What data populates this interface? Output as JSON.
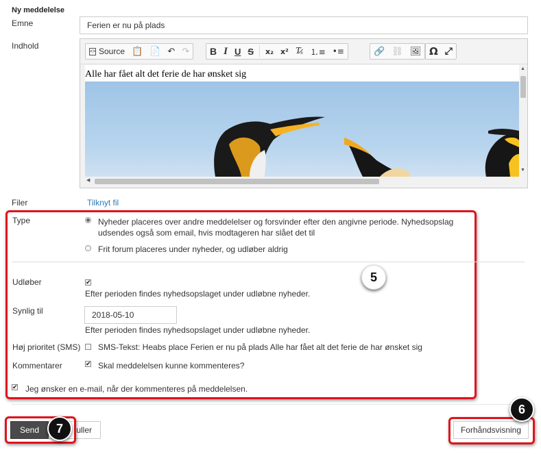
{
  "form": {
    "section_title": "Ny meddelelse",
    "subject_label": "Emne",
    "subject_value": "Ferien er nu på plads",
    "content_label": "Indhold",
    "editor": {
      "source_label": "Source",
      "content_text": "Alle har fået alt det ferie de har ønsket sig"
    },
    "files_label": "Filer",
    "attach_link": "Tilknyt fil",
    "type_label": "Type",
    "type_options": [
      {
        "text": "Nyheder placeres over andre meddelelser og forsvinder efter den angivne periode. Nyhedsopslag udsendes også som email, hvis modtageren har slået det til",
        "checked": true
      },
      {
        "text": "Frit forum placeres under nyheder, og udløber aldrig",
        "checked": false
      }
    ],
    "expires_label": "Udløber",
    "expires_checked": true,
    "expires_help": "Efter perioden findes nyhedsopslaget under udløbne nyheder.",
    "visible_until_label": "Synlig til",
    "visible_until_value": "2018-05-10",
    "visible_until_help": "Efter perioden findes nyhedsopslaget under udløbne nyheder.",
    "high_priority_label": "Høj prioritet (SMS)",
    "high_priority_checked": false,
    "sms_text": "SMS-Tekst: Heabs place Ferien er nu på plads Alle har fået alt det ferie de har ønsket sig",
    "comments_label": "Kommentarer",
    "comments_checked": true,
    "comments_text": "Skal meddelelsen kunne kommenteres?",
    "email_notify_checked": true,
    "email_notify_text": "Jeg ønsker en e-mail, når der kommenteres på meddelelsen."
  },
  "buttons": {
    "send": "Send",
    "cancel_partial": "uller",
    "preview": "Forhåndsvisning"
  },
  "markers": {
    "m5": "5",
    "m6": "6",
    "m7": "7"
  },
  "colors": {
    "highlight_red": "#e0121b",
    "link_blue": "#2a7ab8",
    "send_button": "#4a4a4a"
  }
}
